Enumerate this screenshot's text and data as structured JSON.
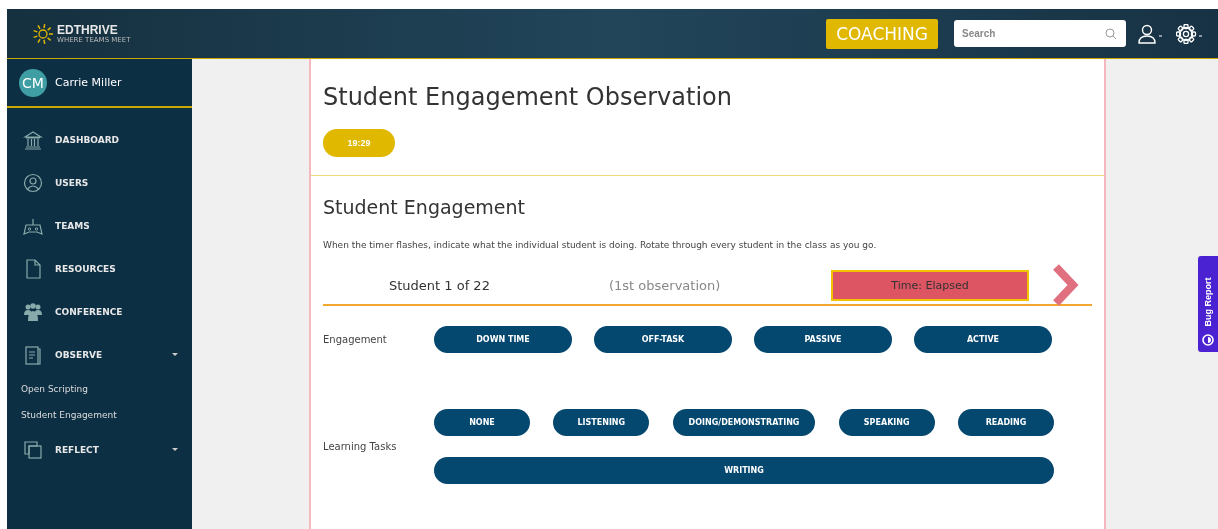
{
  "header": {
    "logo": {
      "name": "EDTHRIVE",
      "tagline": "WHERE TEAMS MEET"
    },
    "mode_button": "COACHING",
    "search": {
      "placeholder": "Search"
    }
  },
  "sidebar": {
    "user": {
      "initials": "CM",
      "name": "Carrie Miller"
    },
    "items": [
      {
        "label": "DASHBOARD",
        "kind": "menu"
      },
      {
        "label": "USERS",
        "kind": "menu"
      },
      {
        "label": "TEAMS",
        "kind": "menu"
      },
      {
        "label": "RESOURCES",
        "kind": "menu"
      },
      {
        "label": "CONFERENCE",
        "kind": "menu"
      },
      {
        "label": "OBSERVE",
        "kind": "group",
        "children": [
          {
            "label": "Open Scripting"
          },
          {
            "label": "Student Engagement"
          }
        ]
      },
      {
        "label": "REFLECT",
        "kind": "group"
      }
    ]
  },
  "page": {
    "title": "Student Engagement Observation",
    "timer": "19:29",
    "section": {
      "title": "Student Engagement",
      "instructions": "When the timer flashes, indicate what the individual student is doing. Rotate through every student in the class as you go.",
      "student": "Student 1 of 22",
      "observation": "(1st observation)",
      "time_status": "Time: Elapsed",
      "groups": [
        {
          "label": "Engagement",
          "options": [
            {
              "label": "DOWN TIME",
              "selected": false
            },
            {
              "label": "OFF-TASK",
              "selected": false
            },
            {
              "label": "PASSIVE",
              "selected": false
            },
            {
              "label": "ACTIVE",
              "selected": false
            }
          ]
        },
        {
          "label": "Learning Tasks",
          "options": [
            {
              "label": "NONE",
              "selected": false
            },
            {
              "label": "LISTENING",
              "selected": false
            },
            {
              "label": "DOING/DEMONSTRATING",
              "selected": false
            },
            {
              "label": "SPEAKING",
              "selected": false
            },
            {
              "label": "READING",
              "selected": false
            },
            {
              "label": "WRITING",
              "selected": false
            }
          ]
        }
      ]
    }
  },
  "bug_report": "Bug Report"
}
